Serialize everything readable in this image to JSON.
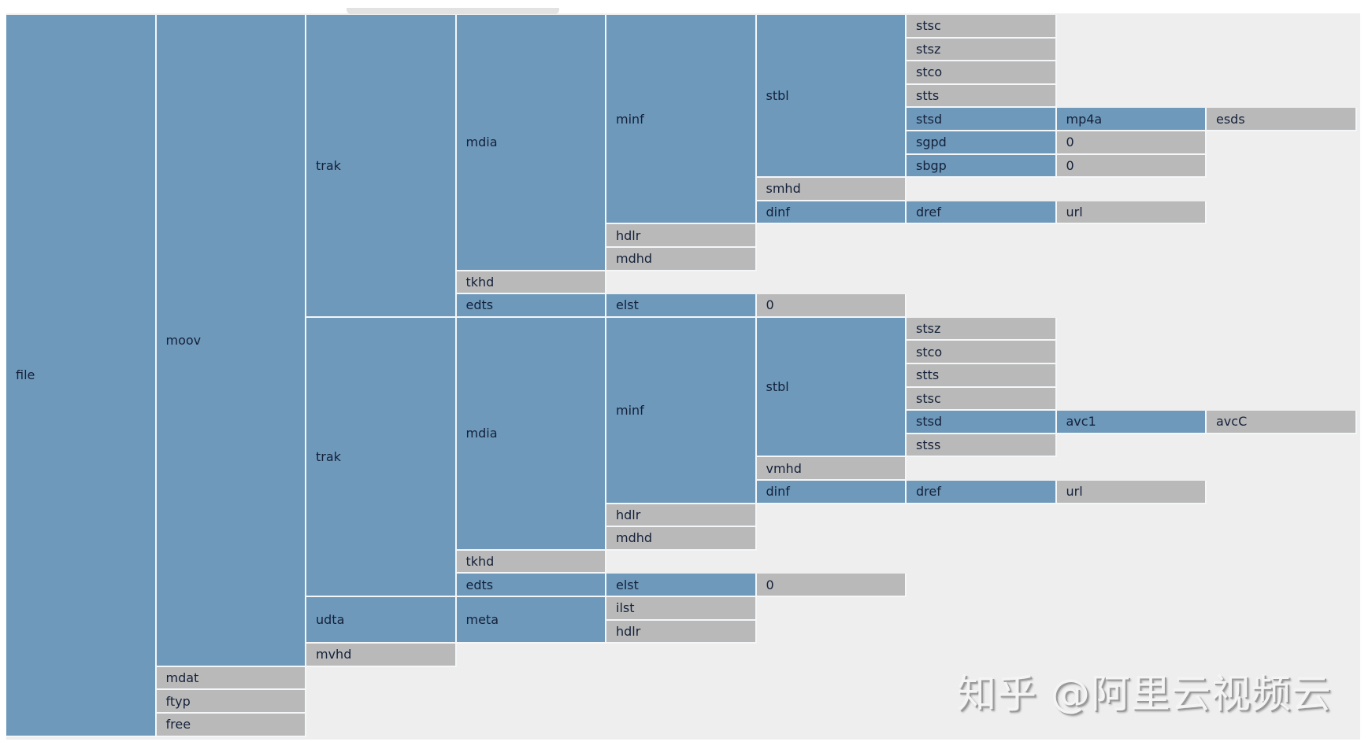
{
  "colors": {
    "branch": "#6e99bb",
    "leaf": "#b9b9b9",
    "background": "#eeeeee",
    "text": "#14213a"
  },
  "watermark": "知乎 @阿里云视频云",
  "tree": {
    "name": "file",
    "children": [
      {
        "name": "moov",
        "children": [
          {
            "name": "trak",
            "children": [
              {
                "name": "mdia",
                "children": [
                  {
                    "name": "minf",
                    "children": [
                      {
                        "name": "stbl",
                        "children": [
                          {
                            "name": "stsc"
                          },
                          {
                            "name": "stsz"
                          },
                          {
                            "name": "stco"
                          },
                          {
                            "name": "stts"
                          },
                          {
                            "name": "stsd",
                            "children": [
                              {
                                "name": "mp4a",
                                "children": [
                                  {
                                    "name": "esds"
                                  }
                                ]
                              }
                            ]
                          },
                          {
                            "name": "sgpd",
                            "children": [
                              {
                                "name": "0"
                              }
                            ]
                          },
                          {
                            "name": "sbgp",
                            "children": [
                              {
                                "name": "0"
                              }
                            ]
                          }
                        ]
                      },
                      {
                        "name": "smhd"
                      },
                      {
                        "name": "dinf",
                        "children": [
                          {
                            "name": "dref",
                            "children": [
                              {
                                "name": "url"
                              }
                            ]
                          }
                        ]
                      }
                    ]
                  },
                  {
                    "name": "hdlr"
                  },
                  {
                    "name": "mdhd"
                  }
                ]
              },
              {
                "name": "tkhd"
              },
              {
                "name": "edts",
                "children": [
                  {
                    "name": "elst",
                    "children": [
                      {
                        "name": "0"
                      }
                    ]
                  }
                ]
              }
            ]
          },
          {
            "name": "trak",
            "children": [
              {
                "name": "mdia",
                "children": [
                  {
                    "name": "minf",
                    "children": [
                      {
                        "name": "stbl",
                        "children": [
                          {
                            "name": "stsz"
                          },
                          {
                            "name": "stco"
                          },
                          {
                            "name": "stts"
                          },
                          {
                            "name": "stsc"
                          },
                          {
                            "name": "stsd",
                            "children": [
                              {
                                "name": "avc1",
                                "children": [
                                  {
                                    "name": "avcC"
                                  }
                                ]
                              }
                            ]
                          },
                          {
                            "name": "stss"
                          }
                        ]
                      },
                      {
                        "name": "vmhd"
                      },
                      {
                        "name": "dinf",
                        "children": [
                          {
                            "name": "dref",
                            "children": [
                              {
                                "name": "url"
                              }
                            ]
                          }
                        ]
                      }
                    ]
                  },
                  {
                    "name": "hdlr"
                  },
                  {
                    "name": "mdhd"
                  }
                ]
              },
              {
                "name": "tkhd"
              },
              {
                "name": "edts",
                "children": [
                  {
                    "name": "elst",
                    "children": [
                      {
                        "name": "0"
                      }
                    ]
                  }
                ]
              }
            ]
          },
          {
            "name": "udta",
            "children": [
              {
                "name": "meta",
                "children": [
                  {
                    "name": "ilst"
                  },
                  {
                    "name": "hdlr"
                  }
                ]
              }
            ]
          },
          {
            "name": "mvhd"
          }
        ]
      },
      {
        "name": "mdat"
      },
      {
        "name": "ftyp"
      },
      {
        "name": "free"
      }
    ]
  }
}
